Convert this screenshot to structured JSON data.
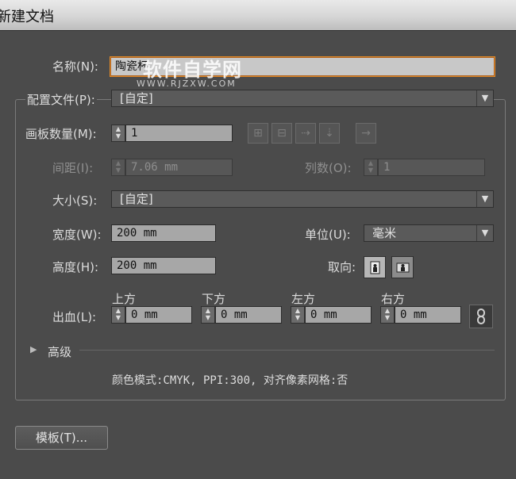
{
  "window": {
    "title": "新建文档"
  },
  "name": {
    "label": "名称(N):",
    "value": "陶瓷杯"
  },
  "watermark": {
    "main": "软件自学网",
    "url": "WWW.RJZXW.COM"
  },
  "profile": {
    "label": "配置文件(P):",
    "value": "[自定]"
  },
  "artboards": {
    "count_label": "画板数量(M):",
    "count_value": "1",
    "spacing_label": "间距(I):",
    "spacing_value": "7.06 mm",
    "columns_label": "列数(O):",
    "columns_value": "1"
  },
  "size": {
    "label": "大小(S):",
    "value": "[自定]"
  },
  "width": {
    "label": "宽度(W):",
    "value": "200 mm"
  },
  "height": {
    "label": "高度(H):",
    "value": "200 mm"
  },
  "units": {
    "label": "单位(U):",
    "value": "毫米"
  },
  "orientation": {
    "label": "取向:"
  },
  "bleed": {
    "label": "出血(L):",
    "top_label": "上方",
    "top_value": "0 mm",
    "bottom_label": "下方",
    "bottom_value": "0 mm",
    "left_label": "左方",
    "left_value": "0 mm",
    "right_label": "右方",
    "right_value": "0 mm"
  },
  "advanced": {
    "label": "高级",
    "summary": "颜色模式:CMYK, PPI:300, 对齐像素网格:否"
  },
  "templates_button": "模板(T)...",
  "colors": {
    "background": "#4b4b4b",
    "focus_border": "#e18a29",
    "field": "#a7a7a7"
  }
}
